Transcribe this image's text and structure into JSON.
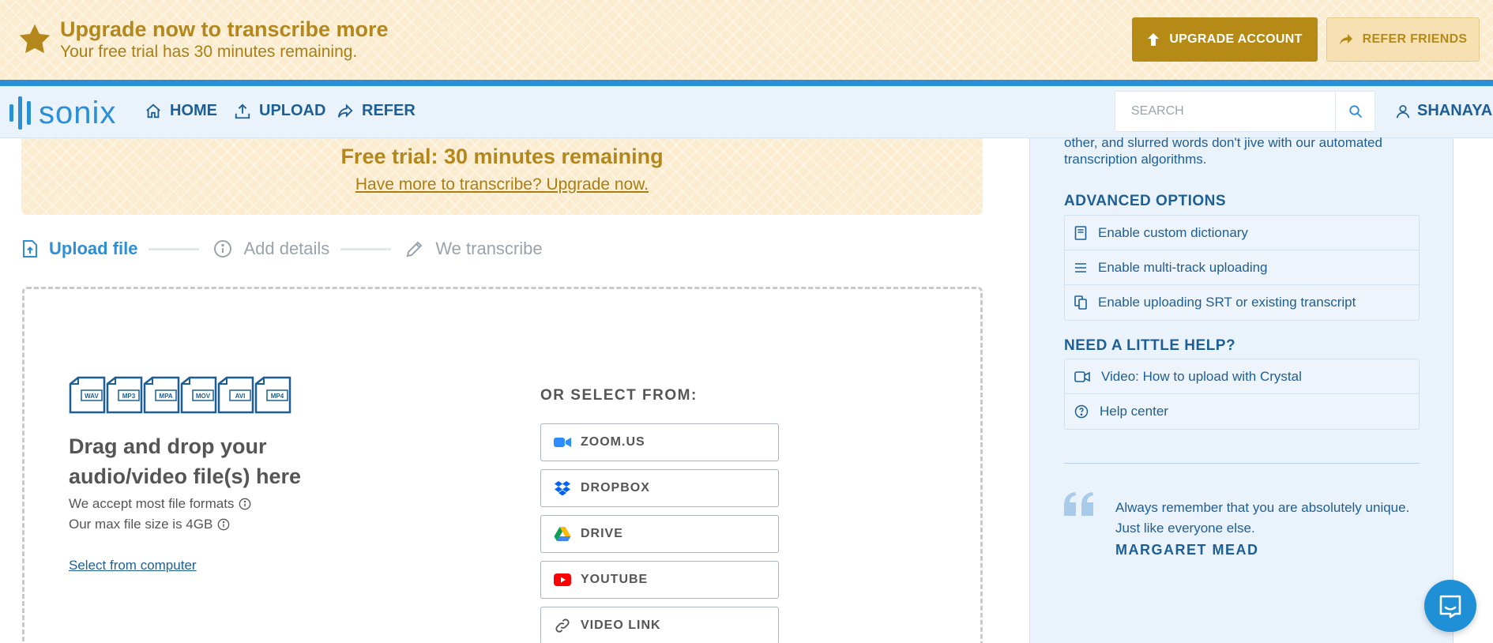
{
  "trial_banner": {
    "title": "Upgrade now to transcribe more",
    "subtitle": "Your free trial has 30 minutes remaining.",
    "upgrade_button": "UPGRADE ACCOUNT",
    "refer_button": "REFER FRIENDS"
  },
  "nav": {
    "logo": "sonix",
    "links": [
      "HOME",
      "UPLOAD",
      "REFER"
    ],
    "search_placeholder": "SEARCH",
    "user": "SHANAYA"
  },
  "main_trial": {
    "title": "Free trial: 30 minutes remaining",
    "link": "Have more to transcribe? Upgrade now."
  },
  "steps": [
    {
      "label": "Upload file",
      "active": true
    },
    {
      "label": "Add details",
      "active": false
    },
    {
      "label": "We transcribe",
      "active": false
    }
  ],
  "dropzone": {
    "file_types": [
      "WAV",
      "MP3",
      "MPA",
      "MOV",
      "AVI",
      "MP4"
    ],
    "title": "Drag and drop your audio/video file(s) here",
    "formats_note": "We accept most file formats",
    "size_note": "Our max file size is 4GB",
    "select_link": "Select from computer",
    "select_from_label": "OR SELECT FROM:",
    "sources": [
      "ZOOM.US",
      "DROPBOX",
      "DRIVE",
      "YOUTUBE",
      "VIDEO LINK"
    ]
  },
  "sidebar": {
    "intro_text": "other, and slurred words don't jive with our automated transcription algorithms.",
    "advanced_heading": "ADVANCED OPTIONS",
    "advanced_options": [
      "Enable custom dictionary",
      "Enable multi-track uploading",
      "Enable uploading SRT or existing transcript"
    ],
    "help_heading": "NEED A LITTLE HELP?",
    "help_items": [
      "Video: How to upload with Crystal",
      "Help center"
    ],
    "quote": "Always remember that you are absolutely unique. Just like everyone else.",
    "quote_author": "MARGARET MEAD"
  },
  "colors": {
    "brand_blue": "#2a8fd6",
    "nav_text": "#1d5f95",
    "gold": "#b58a17",
    "banner_bg": "#fbecd0",
    "sidebar_bg": "#eaf2fb"
  }
}
